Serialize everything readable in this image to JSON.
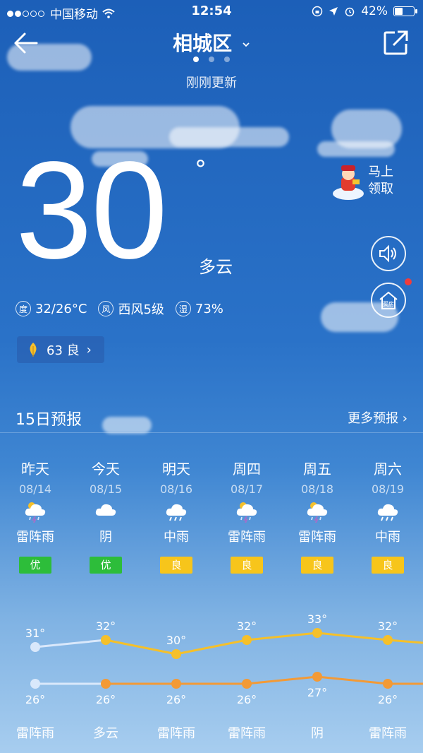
{
  "status_bar": {
    "carrier": "中国移动",
    "time": "12:54",
    "battery": "42%",
    "battery_level": 0.42
  },
  "header": {
    "city": "相城区",
    "updated": "刚刚更新",
    "page_count": 3,
    "active_page": 0
  },
  "current": {
    "temperature": "30",
    "degree_symbol": "°",
    "condition": "多云",
    "range_icon": "度",
    "range": "32/26°C",
    "wind_icon": "风",
    "wind": "西风5级",
    "humidity_icon": "湿",
    "humidity": "73%",
    "aqi": "63 良",
    "aqi_chevron": "›"
  },
  "reward": {
    "line1": "马上",
    "line2": "领取"
  },
  "side_buttons": {
    "house_label": "买房"
  },
  "forecast": {
    "title": "15日预报",
    "more": "更多预报 ›",
    "days": [
      {
        "name": "昨天",
        "date": "08/14",
        "icon": "thunder-rain-icon",
        "weather": "雷阵雨",
        "aqi": "优",
        "aqi_level": "good",
        "high": "31°",
        "low": "26°",
        "night": "雷阵雨"
      },
      {
        "name": "今天",
        "date": "08/15",
        "icon": "cloud-icon",
        "weather": "阴",
        "aqi": "优",
        "aqi_level": "good",
        "high": "32°",
        "low": "26°",
        "night": "多云"
      },
      {
        "name": "明天",
        "date": "08/16",
        "icon": "rain-icon",
        "weather": "中雨",
        "aqi": "良",
        "aqi_level": "mid",
        "high": "30°",
        "low": "26°",
        "night": "雷阵雨"
      },
      {
        "name": "周四",
        "date": "08/17",
        "icon": "thunder-rain-icon",
        "weather": "雷阵雨",
        "aqi": "良",
        "aqi_level": "mid",
        "high": "32°",
        "low": "26°",
        "night": "雷阵雨"
      },
      {
        "name": "周五",
        "date": "08/18",
        "icon": "thunder-rain-icon",
        "weather": "雷阵雨",
        "aqi": "良",
        "aqi_level": "mid",
        "high": "33°",
        "low": "27°",
        "night": "阴"
      },
      {
        "name": "周六",
        "date": "08/19",
        "icon": "rain-icon",
        "weather": "中雨",
        "aqi": "良",
        "aqi_level": "mid",
        "high": "32°",
        "low": "26°",
        "night": "雷阵雨"
      }
    ]
  },
  "colors": {
    "high_line": "#f5c02a",
    "low_line": "#f39a36",
    "past_line": "#d9e8fb",
    "aqi_good": "#2dbd3a",
    "aqi_mid": "#f7c51b"
  }
}
